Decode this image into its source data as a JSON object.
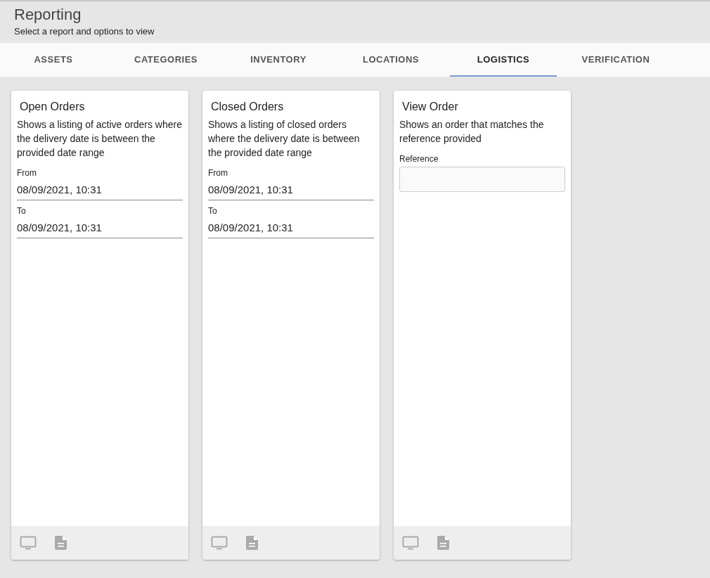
{
  "header": {
    "title": "Reporting",
    "subtitle": "Select a report and options to view"
  },
  "tabs": [
    {
      "label": "ASSETS",
      "selected": false
    },
    {
      "label": "CATEGORIES",
      "selected": false
    },
    {
      "label": "INVENTORY",
      "selected": false
    },
    {
      "label": "LOCATIONS",
      "selected": false
    },
    {
      "label": "LOGISTICS",
      "selected": true
    },
    {
      "label": "VERIFICATION",
      "selected": false
    }
  ],
  "reports": [
    {
      "title": "Open Orders",
      "description": "Shows a listing of active orders where the delivery date is between the provided date range",
      "fields": [
        {
          "kind": "date",
          "label": "From",
          "value": "08/09/2021, 10:31"
        },
        {
          "kind": "date",
          "label": "To",
          "value": "08/09/2021, 10:31"
        }
      ]
    },
    {
      "title": "Closed Orders",
      "description": "Shows a listing of closed orders where the delivery date is between the provided date range",
      "fields": [
        {
          "kind": "date",
          "label": "From",
          "value": "08/09/2021, 10:31"
        },
        {
          "kind": "date",
          "label": "To",
          "value": "08/09/2021, 10:31"
        }
      ]
    },
    {
      "title": "View Order",
      "description": "Shows an order that matches the reference provided",
      "fields": [
        {
          "kind": "text",
          "label": "Reference"
        }
      ]
    }
  ]
}
